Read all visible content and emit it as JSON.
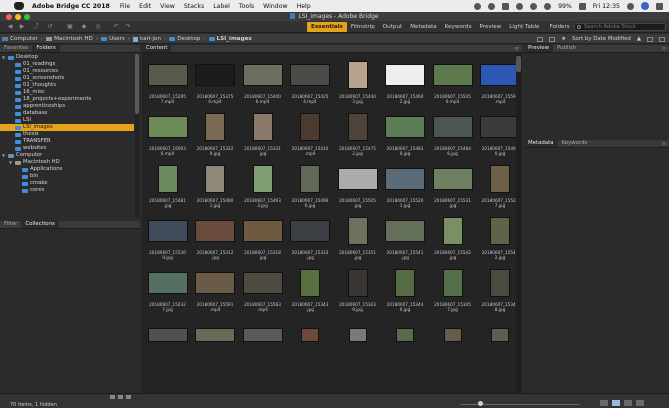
{
  "menubar": {
    "app_name": "Adobe Bridge CC 2018",
    "items": [
      "File",
      "Edit",
      "View",
      "Stacks",
      "Label",
      "Tools",
      "Window",
      "Help"
    ],
    "battery": "99%",
    "clock": "Fri 12:35"
  },
  "window": {
    "title": "LSI_images - Adobe Bridge"
  },
  "toolbar": {
    "workspaces": [
      "Essentials",
      "Filmstrip",
      "Output",
      "Metadata",
      "Keywords",
      "Preview",
      "Light Table"
    ],
    "active_workspace": "Essentials",
    "folders_dropdown": "Folders",
    "search_placeholder": "Search Adobe Stock"
  },
  "pathbar": {
    "crumbs": [
      "Computer",
      "Macintosh HD",
      "Users",
      "karl-jon",
      "Desktop",
      "LSI_images"
    ],
    "sort_label": "Sort by Date Modified"
  },
  "left_panel": {
    "tabs": [
      "Favorites",
      "Folders"
    ],
    "active_tab": "Folders",
    "tree": [
      {
        "label": "Desktop",
        "depth": 0,
        "expanded": true,
        "kind": "folder"
      },
      {
        "label": "01_readings",
        "depth": 1,
        "kind": "folder"
      },
      {
        "label": "01_resources",
        "depth": 1,
        "kind": "folder"
      },
      {
        "label": "01_screenshots",
        "depth": 1,
        "kind": "folder"
      },
      {
        "label": "01_thoughts",
        "depth": 1,
        "kind": "folder"
      },
      {
        "label": "16_misc",
        "depth": 1,
        "kind": "folder"
      },
      {
        "label": "18_projects+experiments",
        "depth": 1,
        "kind": "folder"
      },
      {
        "label": "apprenticeships",
        "depth": 1,
        "kind": "folder"
      },
      {
        "label": "database",
        "depth": 1,
        "kind": "folder"
      },
      {
        "label": "LSI",
        "depth": 1,
        "kind": "folder"
      },
      {
        "label": "LSI_images",
        "depth": 1,
        "kind": "folder",
        "selected": true
      },
      {
        "label": "thesis",
        "depth": 1,
        "kind": "folder"
      },
      {
        "label": "TRANSFER",
        "depth": 1,
        "kind": "folder"
      },
      {
        "label": "websites",
        "depth": 1,
        "kind": "folder"
      },
      {
        "label": "Computer",
        "depth": 0,
        "expanded": true,
        "kind": "computer"
      },
      {
        "label": "Macintosh HD",
        "depth": 1,
        "expanded": true,
        "kind": "drive"
      },
      {
        "label": "Applications",
        "depth": 2,
        "kind": "folder"
      },
      {
        "label": "bin",
        "depth": 2,
        "kind": "folder"
      },
      {
        "label": "cmake",
        "depth": 2,
        "kind": "folder"
      },
      {
        "label": "cores",
        "depth": 2,
        "kind": "folder"
      }
    ]
  },
  "filter_panel": {
    "tabs": [
      "Filter",
      "Collections"
    ],
    "active_tab": "Collections"
  },
  "content_panel": {
    "tab": "Content",
    "items": [
      {
        "name": "20180607_15295\n7.mp4",
        "color": "#5a5a4a",
        "w": 40,
        "h": 22
      },
      {
        "name": "20180607_15375\n4.mp4",
        "color": "#1c1c1c",
        "w": 40,
        "h": 22
      },
      {
        "name": "20180607_15400\n6.mp4",
        "color": "#6a6f60",
        "w": 40,
        "h": 22
      },
      {
        "name": "20180607_15425\n4.mp4",
        "color": "#4c4a46",
        "w": 40,
        "h": 22
      },
      {
        "name": "20180607_15440\n3.jpg",
        "color": "#b7a28e",
        "w": 20,
        "h": 28
      },
      {
        "name": "20180607_15460\n2.jpg",
        "color": "#eeeeee",
        "w": 40,
        "h": 22
      },
      {
        "name": "20180607_15545\n6.mp4",
        "color": "#5d7a4c",
        "w": 40,
        "h": 22
      },
      {
        "name": "20180607_15590\n.mp4",
        "color": "#2c57b5",
        "w": 40,
        "h": 22
      },
      {
        "name": "20180607_16003\n6.mp4",
        "color": "#6b8a55",
        "w": 40,
        "h": 22
      },
      {
        "name": "20180607_15322\n9.jpg",
        "color": "#7a6a54",
        "w": 20,
        "h": 28
      },
      {
        "name": "20180607_15331\n.jpg",
        "color": "#8a7868",
        "w": 20,
        "h": 28
      },
      {
        "name": "20180607_15410\n.mp4",
        "color": "#4a3a30",
        "w": 20,
        "h": 28
      },
      {
        "name": "20180607_15475\n2.jpg",
        "color": "#4e4338",
        "w": 20,
        "h": 28
      },
      {
        "name": "20180607_15483\n0.jpg",
        "color": "#5d7d56",
        "w": 40,
        "h": 22
      },
      {
        "name": "20180607_15484\n6.jpg",
        "color": "#4c5650",
        "w": 40,
        "h": 22
      },
      {
        "name": "20180607_15491\n0.jpg",
        "color": "#3a3a3a",
        "w": 40,
        "h": 22
      },
      {
        "name": "20180607_15481\n.jpg",
        "color": "#6b8b5e",
        "w": 20,
        "h": 28
      },
      {
        "name": "20180607_15490\n1.jpg",
        "color": "#8f8778",
        "w": 20,
        "h": 28
      },
      {
        "name": "20180607_15493\n3.jpg",
        "color": "#7f9c72",
        "w": 20,
        "h": 28
      },
      {
        "name": "20180607_15496\n6.jpg",
        "color": "#5f6955",
        "w": 20,
        "h": 28
      },
      {
        "name": "20180607_15505\n.jpg",
        "color": "#a9aca8",
        "w": 40,
        "h": 22
      },
      {
        "name": "20180607_15520\n1.jpg",
        "color": "#5b6b78",
        "w": 40,
        "h": 22
      },
      {
        "name": "20180607_15531\n.jpg",
        "color": "#6e8062",
        "w": 40,
        "h": 22
      },
      {
        "name": "20180607_15521\n7.jpg",
        "color": "#6d5f48",
        "w": 20,
        "h": 28
      },
      {
        "name": "20180607_15530\n9.jpg",
        "color": "#3f4d5a",
        "w": 40,
        "h": 22
      },
      {
        "name": "20180607_15312\n.jpg",
        "color": "#6a4a3a",
        "w": 40,
        "h": 22
      },
      {
        "name": "20180607_15318\n.jpg",
        "color": "#6f5a40",
        "w": 40,
        "h": 22
      },
      {
        "name": "20180607_15333\n.jpg",
        "color": "#3b3f44",
        "w": 40,
        "h": 22
      },
      {
        "name": "20180607_15351\n.jpg",
        "color": "#70705f",
        "w": 20,
        "h": 28
      },
      {
        "name": "20180607_15541\n.jpg",
        "color": "#64705a",
        "w": 40,
        "h": 22
      },
      {
        "name": "20180607_15542\n.jpg",
        "color": "#7a8f64",
        "w": 20,
        "h": 28
      },
      {
        "name": "20180607_15542\n2.jpg",
        "color": "#5d6448",
        "w": 20,
        "h": 28
      },
      {
        "name": "20180607_15432\n7.jpg",
        "color": "#557060",
        "w": 40,
        "h": 22
      },
      {
        "name": "20180607_15591\n.mp4",
        "color": "#6a5a48",
        "w": 40,
        "h": 22
      },
      {
        "name": "20180607_15583\n.mp4",
        "color": "#4f4a40",
        "w": 40,
        "h": 22
      },
      {
        "name": "20180607_15343\n.jpg",
        "color": "#58703f",
        "w": 20,
        "h": 28
      },
      {
        "name": "20180607_15343\n9.jpg",
        "color": "#3a3634",
        "w": 20,
        "h": 28
      },
      {
        "name": "20180607_15344\n0.jpg",
        "color": "#556b45",
        "w": 20,
        "h": 28
      },
      {
        "name": "20180607_15345\n7.jpg",
        "color": "#556f4a",
        "w": 20,
        "h": 28
      },
      {
        "name": "20180607_15345\n8.jpg",
        "color": "#4a4a3e",
        "w": 20,
        "h": 28
      },
      {
        "name": "",
        "color": "#505050",
        "w": 40,
        "h": 14
      },
      {
        "name": "",
        "color": "#6a6a58",
        "w": 40,
        "h": 14
      },
      {
        "name": "",
        "color": "#5a5a5a",
        "w": 40,
        "h": 14
      },
      {
        "name": "",
        "color": "#6f4a3a",
        "w": 18,
        "h": 14
      },
      {
        "name": "",
        "color": "#7a7a7a",
        "w": 18,
        "h": 14
      },
      {
        "name": "",
        "color": "#5a6a4a",
        "w": 18,
        "h": 14
      },
      {
        "name": "",
        "color": "#6a5a4a",
        "w": 18,
        "h": 14
      },
      {
        "name": "",
        "color": "#5e5e4e",
        "w": 18,
        "h": 14
      }
    ]
  },
  "preview_panel": {
    "tabs": [
      "Preview",
      "Publish"
    ],
    "active_tab": "Preview"
  },
  "metadata_panel": {
    "tabs": [
      "Metadata",
      "Keywords"
    ],
    "active_tab": "Metadata"
  },
  "statusbar": {
    "item_count": "70 items, 1 hidden"
  },
  "colors": {
    "accent": "#e6a21a",
    "folder": "#3f8fd8"
  }
}
